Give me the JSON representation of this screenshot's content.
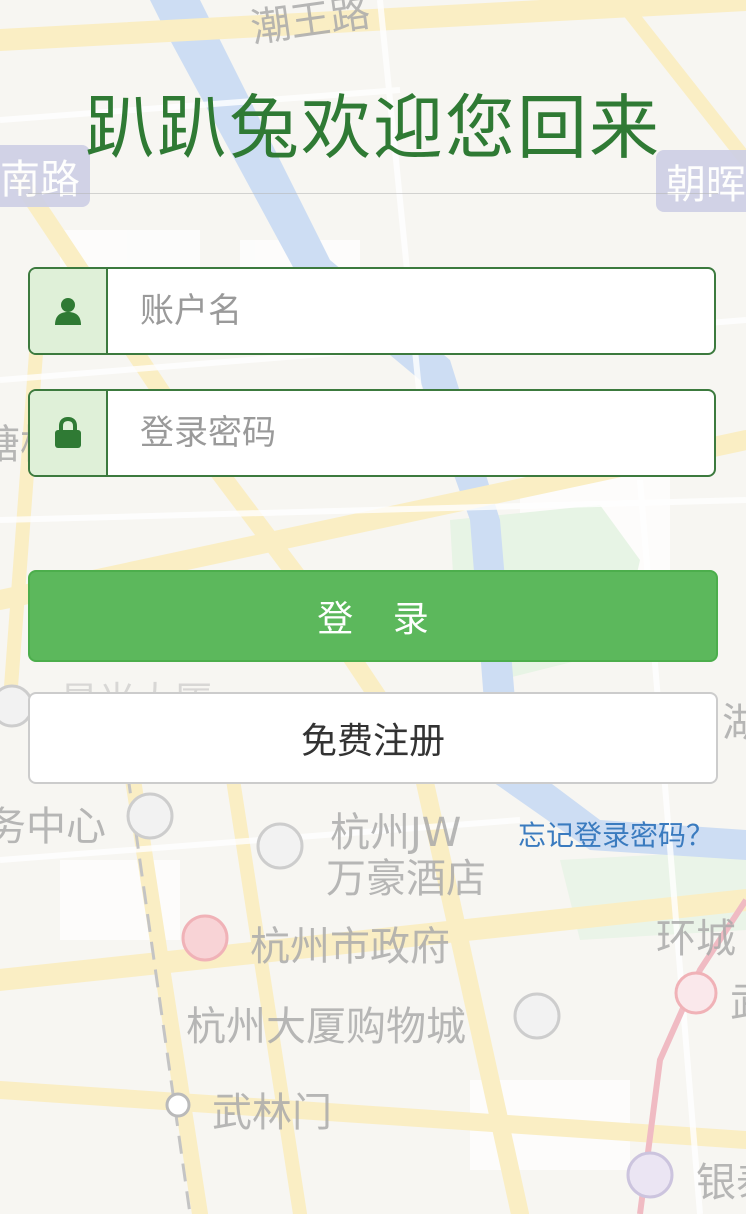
{
  "header": {
    "title": "趴趴兔欢迎您回来"
  },
  "form": {
    "username": {
      "placeholder": "账户名",
      "value": ""
    },
    "password": {
      "placeholder": "登录密码",
      "value": ""
    }
  },
  "buttons": {
    "login": "登 录",
    "register": "免费注册"
  },
  "links": {
    "forgot_password": "忘记登录密码？"
  },
  "map": {
    "labels": {
      "road_top": "潮王路",
      "road_left": "南路",
      "badge_right": "朝晖",
      "left_edge": "塘枯",
      "poi_left_cut": "务中心",
      "poi_top_cut": "星光大厦",
      "hotel_line1": "杭州JW",
      "hotel_line2": "万豪酒店",
      "gov": "杭州市政府",
      "mall": "杭州大厦购物城",
      "station": "武林门",
      "ring_road": "环城",
      "right_edge_1": "湖",
      "right_edge_2": "武",
      "bank": "银泰"
    }
  },
  "colors": {
    "accent_green": "#2f7a34",
    "button_green": "#5cb85c",
    "link_blue": "#3a7bbf",
    "addon_bg": "#dff0d8"
  }
}
